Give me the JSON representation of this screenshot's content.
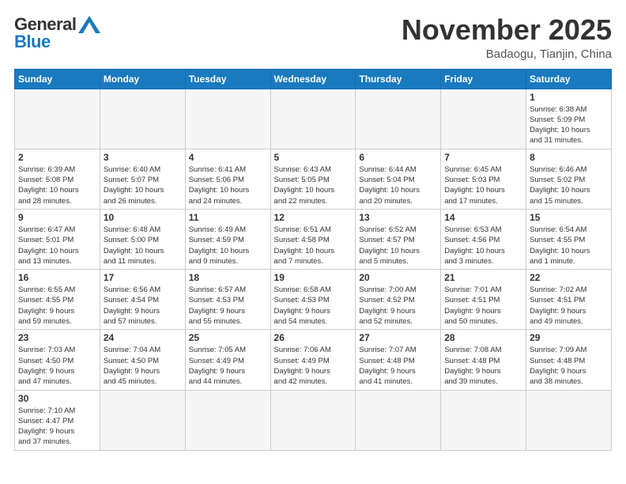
{
  "logo": {
    "general": "General",
    "blue": "Blue"
  },
  "title": "November 2025",
  "location": "Badaogu, Tianjin, China",
  "weekdays": [
    "Sunday",
    "Monday",
    "Tuesday",
    "Wednesday",
    "Thursday",
    "Friday",
    "Saturday"
  ],
  "weeks": [
    [
      {
        "day": "",
        "info": ""
      },
      {
        "day": "",
        "info": ""
      },
      {
        "day": "",
        "info": ""
      },
      {
        "day": "",
        "info": ""
      },
      {
        "day": "",
        "info": ""
      },
      {
        "day": "",
        "info": ""
      },
      {
        "day": "1",
        "info": "Sunrise: 6:38 AM\nSunset: 5:09 PM\nDaylight: 10 hours\nand 31 minutes."
      }
    ],
    [
      {
        "day": "2",
        "info": "Sunrise: 6:39 AM\nSunset: 5:08 PM\nDaylight: 10 hours\nand 28 minutes."
      },
      {
        "day": "3",
        "info": "Sunrise: 6:40 AM\nSunset: 5:07 PM\nDaylight: 10 hours\nand 26 minutes."
      },
      {
        "day": "4",
        "info": "Sunrise: 6:41 AM\nSunset: 5:06 PM\nDaylight: 10 hours\nand 24 minutes."
      },
      {
        "day": "5",
        "info": "Sunrise: 6:43 AM\nSunset: 5:05 PM\nDaylight: 10 hours\nand 22 minutes."
      },
      {
        "day": "6",
        "info": "Sunrise: 6:44 AM\nSunset: 5:04 PM\nDaylight: 10 hours\nand 20 minutes."
      },
      {
        "day": "7",
        "info": "Sunrise: 6:45 AM\nSunset: 5:03 PM\nDaylight: 10 hours\nand 17 minutes."
      },
      {
        "day": "8",
        "info": "Sunrise: 6:46 AM\nSunset: 5:02 PM\nDaylight: 10 hours\nand 15 minutes."
      }
    ],
    [
      {
        "day": "9",
        "info": "Sunrise: 6:47 AM\nSunset: 5:01 PM\nDaylight: 10 hours\nand 13 minutes."
      },
      {
        "day": "10",
        "info": "Sunrise: 6:48 AM\nSunset: 5:00 PM\nDaylight: 10 hours\nand 11 minutes."
      },
      {
        "day": "11",
        "info": "Sunrise: 6:49 AM\nSunset: 4:59 PM\nDaylight: 10 hours\nand 9 minutes."
      },
      {
        "day": "12",
        "info": "Sunrise: 6:51 AM\nSunset: 4:58 PM\nDaylight: 10 hours\nand 7 minutes."
      },
      {
        "day": "13",
        "info": "Sunrise: 6:52 AM\nSunset: 4:57 PM\nDaylight: 10 hours\nand 5 minutes."
      },
      {
        "day": "14",
        "info": "Sunrise: 6:53 AM\nSunset: 4:56 PM\nDaylight: 10 hours\nand 3 minutes."
      },
      {
        "day": "15",
        "info": "Sunrise: 6:54 AM\nSunset: 4:55 PM\nDaylight: 10 hours\nand 1 minute."
      }
    ],
    [
      {
        "day": "16",
        "info": "Sunrise: 6:55 AM\nSunset: 4:55 PM\nDaylight: 9 hours\nand 59 minutes."
      },
      {
        "day": "17",
        "info": "Sunrise: 6:56 AM\nSunset: 4:54 PM\nDaylight: 9 hours\nand 57 minutes."
      },
      {
        "day": "18",
        "info": "Sunrise: 6:57 AM\nSunset: 4:53 PM\nDaylight: 9 hours\nand 55 minutes."
      },
      {
        "day": "19",
        "info": "Sunrise: 6:58 AM\nSunset: 4:53 PM\nDaylight: 9 hours\nand 54 minutes."
      },
      {
        "day": "20",
        "info": "Sunrise: 7:00 AM\nSunset: 4:52 PM\nDaylight: 9 hours\nand 52 minutes."
      },
      {
        "day": "21",
        "info": "Sunrise: 7:01 AM\nSunset: 4:51 PM\nDaylight: 9 hours\nand 50 minutes."
      },
      {
        "day": "22",
        "info": "Sunrise: 7:02 AM\nSunset: 4:51 PM\nDaylight: 9 hours\nand 49 minutes."
      }
    ],
    [
      {
        "day": "23",
        "info": "Sunrise: 7:03 AM\nSunset: 4:50 PM\nDaylight: 9 hours\nand 47 minutes."
      },
      {
        "day": "24",
        "info": "Sunrise: 7:04 AM\nSunset: 4:50 PM\nDaylight: 9 hours\nand 45 minutes."
      },
      {
        "day": "25",
        "info": "Sunrise: 7:05 AM\nSunset: 4:49 PM\nDaylight: 9 hours\nand 44 minutes."
      },
      {
        "day": "26",
        "info": "Sunrise: 7:06 AM\nSunset: 4:49 PM\nDaylight: 9 hours\nand 42 minutes."
      },
      {
        "day": "27",
        "info": "Sunrise: 7:07 AM\nSunset: 4:48 PM\nDaylight: 9 hours\nand 41 minutes."
      },
      {
        "day": "28",
        "info": "Sunrise: 7:08 AM\nSunset: 4:48 PM\nDaylight: 9 hours\nand 39 minutes."
      },
      {
        "day": "29",
        "info": "Sunrise: 7:09 AM\nSunset: 4:48 PM\nDaylight: 9 hours\nand 38 minutes."
      }
    ],
    [
      {
        "day": "30",
        "info": "Sunrise: 7:10 AM\nSunset: 4:47 PM\nDaylight: 9 hours\nand 37 minutes."
      },
      {
        "day": "",
        "info": ""
      },
      {
        "day": "",
        "info": ""
      },
      {
        "day": "",
        "info": ""
      },
      {
        "day": "",
        "info": ""
      },
      {
        "day": "",
        "info": ""
      },
      {
        "day": "",
        "info": ""
      }
    ]
  ]
}
